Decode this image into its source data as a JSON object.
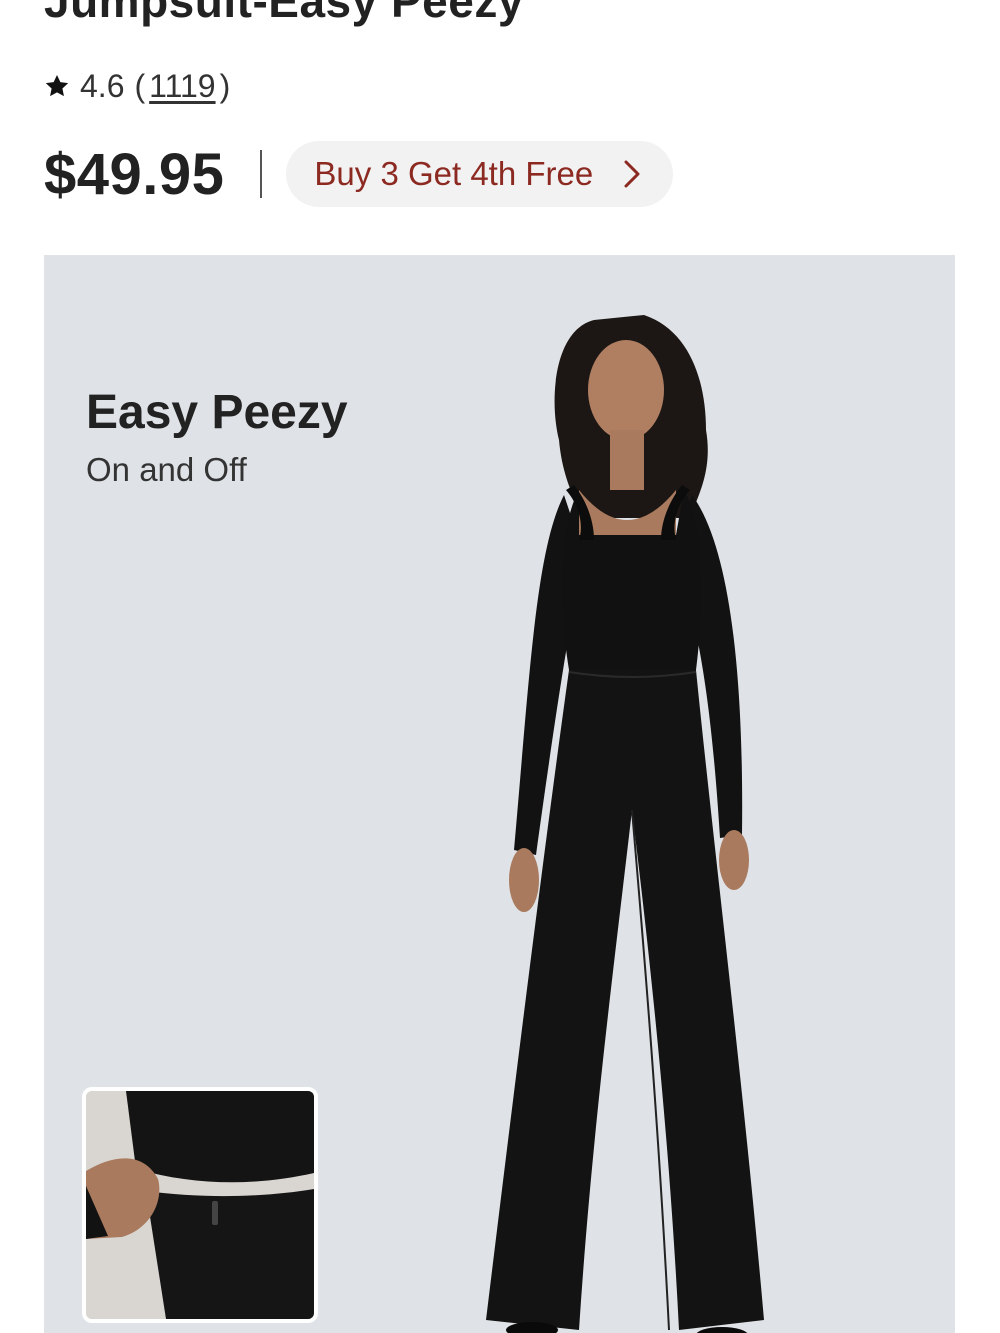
{
  "product": {
    "title": "Jumpsuit-Easy Peezy",
    "rating": "4.6",
    "rating_open": "(",
    "review_count": "1119",
    "rating_close": ")",
    "price": "$49.95"
  },
  "promo": {
    "label": "Buy 3 Get 4th Free",
    "color": "#8c2a22"
  },
  "hero": {
    "heading": "Easy Peezy",
    "subheading": "On and Off",
    "background": "#dfe2e6"
  },
  "icons": {
    "star": "star-icon",
    "chevron": "chevron-right-icon"
  }
}
